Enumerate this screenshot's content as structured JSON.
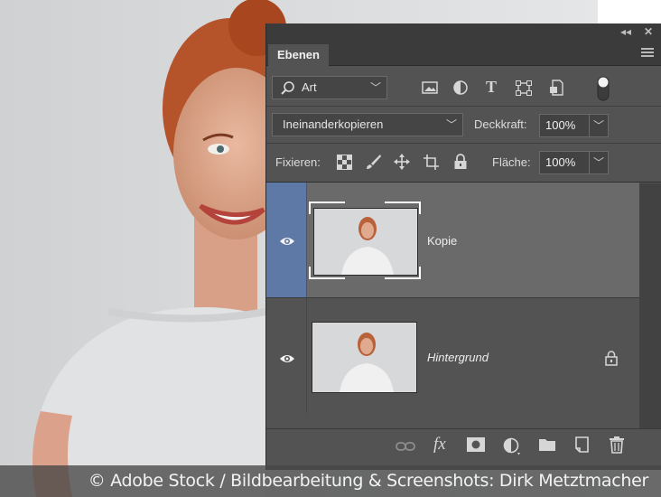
{
  "panel": {
    "tab_label": "Ebenen",
    "collapse_icon": "double-chevron-left-icon",
    "close_icon": "close-icon",
    "menu_icon": "panel-menu-icon"
  },
  "filter": {
    "kind_label": "Art",
    "icons": [
      "image-filter-icon",
      "adjustment-filter-icon",
      "type-filter-icon",
      "shape-filter-icon",
      "smart-object-filter-icon",
      "filter-toggle-icon"
    ]
  },
  "blend": {
    "mode": "Ineinanderkopieren",
    "opacity_label": "Deckkraft:",
    "opacity_value": "100%"
  },
  "lock": {
    "label": "Fixieren:",
    "icons": [
      "lock-transparent-pixels-icon",
      "lock-image-pixels-icon",
      "lock-position-icon",
      "lock-artboard-icon",
      "lock-all-icon"
    ],
    "fill_label": "Fläche:",
    "fill_value": "100%"
  },
  "layers": [
    {
      "name": "Kopie",
      "visible": true,
      "selected": true,
      "locked": false
    },
    {
      "name": "Hintergrund",
      "visible": true,
      "selected": false,
      "locked": true
    }
  ],
  "bottom_icons": [
    "link-layers-icon",
    "fx-icon",
    "layer-mask-icon",
    "new-adjustment-layer-icon",
    "new-group-icon",
    "new-layer-icon",
    "delete-layer-icon"
  ],
  "colors": {
    "panel_bg": "#535353",
    "selected_eye_bg": "#5e79a6",
    "selected_row_bg": "#6a6a6a"
  },
  "credit": "© Adobe Stock / Bildbearbeitung & Screenshots: Dirk Metztmacher"
}
